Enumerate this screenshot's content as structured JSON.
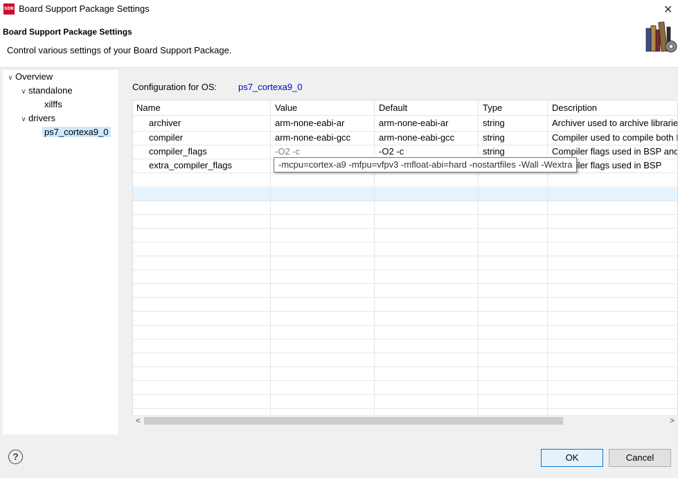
{
  "window": {
    "icon_text": "SDK",
    "title": "Board Support Package Settings",
    "close": "✕"
  },
  "header": {
    "title": "Board Support Package Settings",
    "description": "Control various settings of your Board Support Package."
  },
  "tree": {
    "items": [
      {
        "label": "Overview",
        "level": 0,
        "expanded": true
      },
      {
        "label": "standalone",
        "level": 1,
        "expanded": true
      },
      {
        "label": "xilffs",
        "level": 2
      },
      {
        "label": "drivers",
        "level": 1,
        "expanded": true
      },
      {
        "label": "ps7_cortexa9_0",
        "level": 2,
        "selected": true
      }
    ]
  },
  "config": {
    "label": "Configuration for OS:",
    "value": "ps7_cortexa9_0"
  },
  "table": {
    "columns": [
      "Name",
      "Value",
      "Default",
      "Type",
      "Description"
    ],
    "rows": [
      {
        "name": "archiver",
        "value": "arm-none-eabi-ar",
        "default": "arm-none-eabi-ar",
        "type": "string",
        "description": "Archiver used to archive libraries"
      },
      {
        "name": "compiler",
        "value": "arm-none-eabi-gcc",
        "default": "arm-none-eabi-gcc",
        "type": "string",
        "description": "Compiler used to compile both BSP"
      },
      {
        "name": "compiler_flags",
        "value": "-O2 -c",
        "default": "-O2 -c",
        "type": "string",
        "description": "Compiler flags used in BSP and"
      },
      {
        "name": "extra_compiler_flags",
        "value": "",
        "default": "",
        "type": "",
        "description": "Compiler flags used in BSP"
      }
    ]
  },
  "tooltip": {
    "text": "-mcpu=cortex-a9 -mfpu=vfpv3 -mfloat-abi=hard -nostartfiles -Wall -Wextra"
  },
  "scrollbar": {
    "left": "<",
    "right": ">"
  },
  "footer": {
    "help": "?",
    "ok": "OK",
    "cancel": "Cancel"
  },
  "colors": {
    "accent": "#0078d7",
    "link": "#0000c0",
    "selection": "#cce8ff"
  }
}
